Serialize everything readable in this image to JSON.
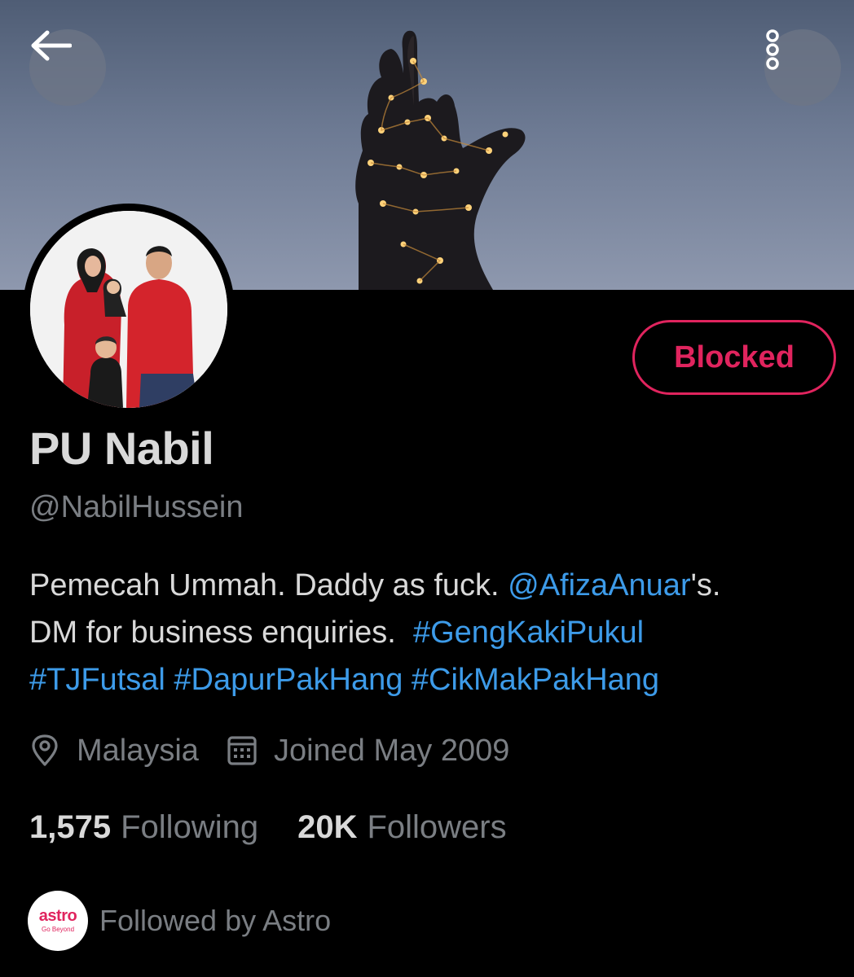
{
  "profile": {
    "name": "PU Nabil",
    "handle": "@NabilHussein",
    "bio_line1_prefix": "Pemecah Ummah. Daddy as fuck. ",
    "bio_mention": "@AfizaAnuar",
    "bio_line1_suffix": "'s.",
    "bio_line2_prefix": "DM for business enquiries.  ",
    "bio_tag1": "#GengKakiPukul",
    "bio_tag2": "#TJFutsal",
    "bio_tag3": "#DapurPakHang",
    "bio_tag4": "#CikMakPakHang",
    "location": "Malaysia",
    "joined": "Joined May 2009"
  },
  "stats": {
    "following_count": "1,575",
    "following_label": "Following",
    "followers_count": "20K",
    "followers_label": "Followers"
  },
  "actions": {
    "blocked_label": "Blocked"
  },
  "followed_by": {
    "logo_text": "astro",
    "logo_tagline": "Go Beyond",
    "text": "Followed by Astro"
  },
  "icons": {
    "back": "arrow-left-icon",
    "more": "more-vertical-icon",
    "location": "location-pin-icon",
    "joined": "calendar-icon"
  },
  "colors": {
    "background": "#000000",
    "accent_link": "#3d9be9",
    "blocked_red": "#e0245e",
    "text_primary": "#d9d9d9",
    "text_secondary": "#7a7e83"
  }
}
